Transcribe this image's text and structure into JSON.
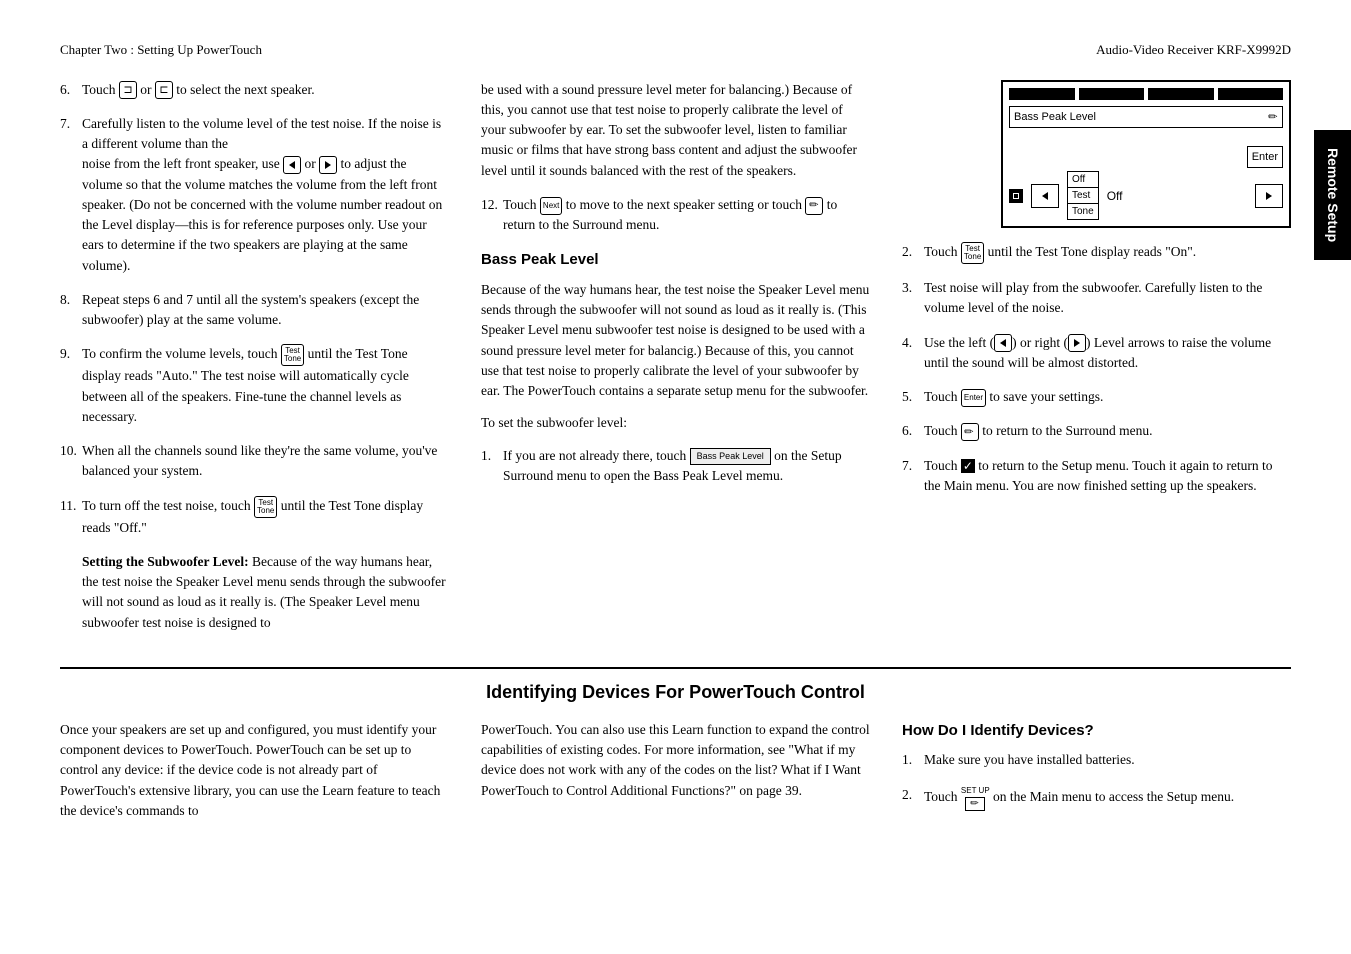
{
  "header": {
    "left": "Chapter Two : Setting Up PowerTouch",
    "right": "Audio-Video Receiver KRF-X9992D"
  },
  "sidetab": "Remote Setup",
  "col1": {
    "li6": "Touch ",
    "li6b": " or ",
    "li6c": " to select the next speaker.",
    "li7a": "Carefully listen to the volume level of the test noise. If the noise is a different volume than the",
    "li7b": "noise from the left front speaker, use ",
    "li7c": " or ",
    "li7d": " to adjust the volume so that the volume matches the volume from the left front speaker. (Do not be concerned with the volume number readout on the Level display—this is for reference purposes only. Use your ears to determine if the two speakers are playing at the same volume).",
    "li8": "Repeat steps 6 and 7 until all the system's speakers (except the subwoofer) play at the same volume.",
    "li9a": "To confirm the volume levels, touch ",
    "li9b": " until the Test Tone display reads \"Auto.\" The test noise will automatically cycle between all of the speakers. Fine-tune the channel levels as necessary.",
    "li10": "When all the channels sound like they're the same volume, you've balanced your system.",
    "li11a": "To turn off the test noise, touch ",
    "li11b": " until the Test Tone display reads \"Off.\"",
    "subhead": "Setting the Subwoofer Level: ",
    "subbody": "Because of the way humans hear, the test noise the Speaker Level menu sends through the subwoofer will not sound as loud as it really is. (The Speaker Level menu subwoofer test noise is designed to"
  },
  "col2": {
    "cont": "be used with a sound pressure level meter for balancing.) Because of this, you cannot use that test noise to properly calibrate the level of your subwoofer by ear. To set the subwoofer level, listen to familiar music or films that have strong bass content and adjust the subwoofer level until it sounds balanced with the rest of the speakers.",
    "li12a": "Touch ",
    "li12b": " to move to the next speaker setting or touch ",
    "li12c": " to return to the Surround menu.",
    "h3": "Bass Peak Level",
    "para": "Because of the way humans hear, the test noise the Speaker Level menu sends through the subwoofer will not sound as loud as it really is. (This Speaker Level menu subwoofer test noise is designed to be used with a sound pressure level meter for balancig.) Because of this, you cannot use that test noise to properly calibrate the level of your subwoofer by ear. The PowerTouch contains a separate setup menu for the subwoofer.",
    "toset": "To set the subwoofer level:",
    "li1a": "If you are not already there, touch ",
    "li1b": " on the Setup Surround menu to open the Bass Peak Level memu.",
    "basspeak_btn": "Bass Peak Level"
  },
  "lcd": {
    "label": "Bass Peak Level",
    "enter": "Enter",
    "off1": "Off",
    "test": "Test",
    "tone": "Tone",
    "off2": "Off"
  },
  "col3": {
    "li2a": "Touch ",
    "li2b": " until the Test Tone display reads \"On\".",
    "li3": "Test noise will play from the subwoofer. Carefully listen to the volume level of the noise.",
    "li4a": "Use the left (",
    "li4b": ") or right (",
    "li4c": ") Level arrows to raise the volume until the sound will be almost distorted.",
    "li5a": "Touch ",
    "li5b": " to save your settings.",
    "li6a": "Touch ",
    "li6b": " to return to the Surround menu.",
    "li7a": "Touch ",
    "li7b": " to return to the Setup menu. Touch it again to return to the Main menu. You are now finished setting up the speakers."
  },
  "bottom": {
    "h2": "Identifying Devices For PowerTouch Control",
    "p1": "Once your speakers are set up and configured, you must identify your component devices to PowerTouch. PowerTouch can be set up to control any device: if the device code is not already part of PowerTouch's extensive library, you can use the Learn feature to teach the device's commands to",
    "p2": "PowerTouch. You can also use this Learn function to expand the control capabilities of existing codes. For more information, see \"What if my device does not work with any of the codes on the list? What if I Want PowerTouch to Control Additional Functions?\" on page 39.",
    "h3": "How Do I Identify Devices?",
    "li1": "Make sure you have installed batteries.",
    "li2a": "Touch ",
    "li2b": " on the Main menu to access the Setup menu.",
    "setup": "SET UP"
  },
  "icons": {
    "next": "Next",
    "test": "Test",
    "tone": "Tone",
    "enter": "Enter"
  }
}
